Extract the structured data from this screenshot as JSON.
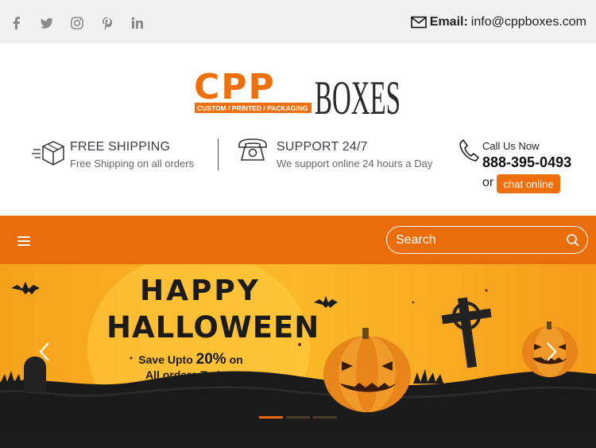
{
  "topbar": {
    "social": [
      "facebook-icon",
      "twitter-icon",
      "instagram-icon",
      "pinterest-icon",
      "linkedin-icon"
    ],
    "email_label": "Email:",
    "email_value": "info@cppboxes.com"
  },
  "logo": {
    "mark": "CPP",
    "tagline": "CUSTOM / PRINTED / PACKAGING",
    "word": "BOXES"
  },
  "features": [
    {
      "title": "FREE SHIPPING",
      "sub": "Free Shipping on all orders",
      "icon": "box-shipping-icon"
    },
    {
      "title": "SUPPORT 24/7",
      "sub": "We support online 24 hours a Day",
      "icon": "telephone-icon"
    }
  ],
  "contact": {
    "label": "Call Us Now",
    "phone": "888-395-0493",
    "or": "or",
    "chat": "chat online"
  },
  "nav": {
    "search_placeholder": "Search"
  },
  "banner": {
    "line1": "HAPPY",
    "line2": "HALLOWEEN",
    "offer_prefix": "Save Upto",
    "offer_pct": "20%",
    "offer_suffix": "on",
    "offer_line2": "All orders Today!",
    "slides": 3,
    "active_slide": 1
  },
  "colors": {
    "brand_orange": "#e96d0a",
    "dark": "#1d1d1d"
  }
}
